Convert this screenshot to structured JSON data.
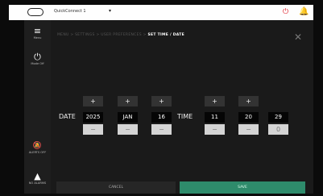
{
  "topbar": {
    "device_name": "QuickConnect 1",
    "chevron": "▾",
    "power_icon": "⏻",
    "bell_icon": "🔔"
  },
  "sidebar": {
    "items": [
      {
        "icon": "≡",
        "label": "Menu"
      },
      {
        "icon": "⏻",
        "label": "Mode Off"
      },
      {
        "icon": "🔕",
        "label": "ALERTS OFF"
      },
      {
        "icon": "▲",
        "label": "NO ALARMS"
      }
    ]
  },
  "breadcrumb": {
    "items": [
      "MENU",
      "SETTINGS",
      "USER PREFERENCES"
    ],
    "separator": ">",
    "current": "SET TIME / DATE"
  },
  "close_icon": "✕",
  "date": {
    "label": "DATE",
    "year": "2025",
    "month": "JAN",
    "day": "16"
  },
  "time": {
    "label": "TIME",
    "hour": "11",
    "minute": "20",
    "second": "29"
  },
  "controls": {
    "plus": "+",
    "minus": "−",
    "zero_value": "0"
  },
  "buttons": {
    "cancel": "CANCEL",
    "save": "SAVE"
  },
  "colors": {
    "accent_save": "#2e8b6b",
    "power_red": "#e0202a"
  }
}
